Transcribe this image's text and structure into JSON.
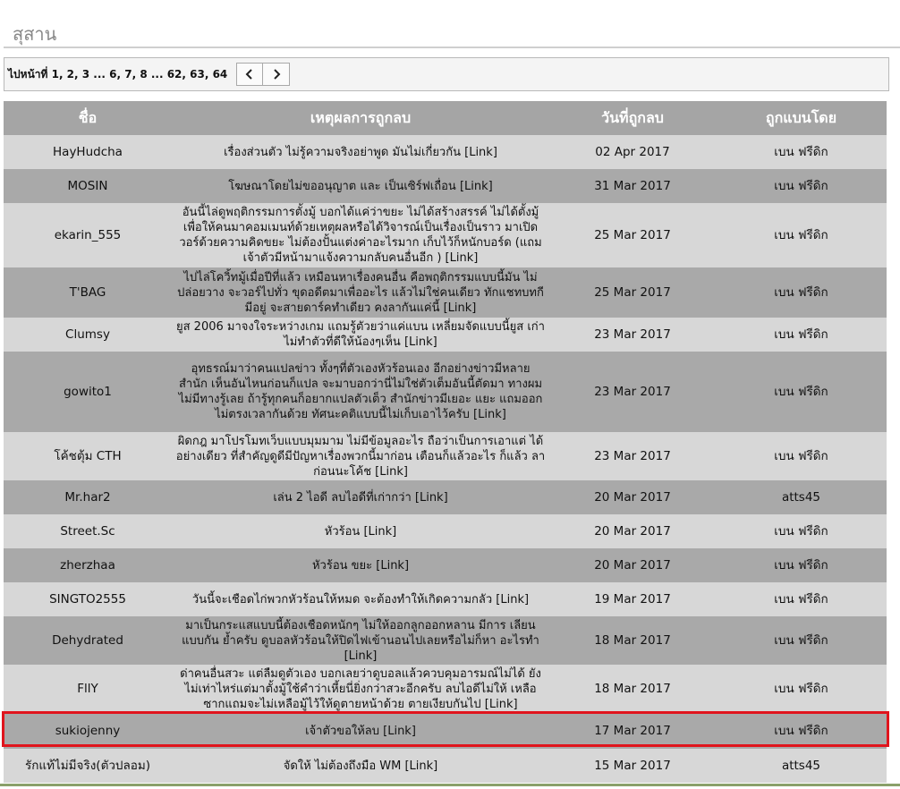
{
  "page": {
    "title": "สุสาน"
  },
  "pager": {
    "text": "ไปหน้าที่ 1, 2, 3 ... 6, 7, 8 ... 62, 63, 64"
  },
  "table": {
    "headers": [
      "ชื่อ",
      "เหตุผลการถูกลบ",
      "วันที่ถูกลบ",
      "ถูกแบนโดย"
    ],
    "rows": [
      {
        "name": "HayHudcha",
        "reason": "เรื่องส่วนตัว ไม่รู้ความจริงอย่าพูด มันไม่เกี่ยวกัน [Link]",
        "date": "02 Apr 2017",
        "by": "เบน ฟรีดิก"
      },
      {
        "name": "MOSIN",
        "reason": "โฆษณาโดยไม่ขออนุญาต และ เป็นเซิร์ฟเถื่อน [Link]",
        "date": "31 Mar 2017",
        "by": "เบน ฟรีดิก"
      },
      {
        "name": "ekarin_555",
        "reason": "อันนี้ไล่ดูพฤติกรรมการตั้งมู้ บอกได้แค่ว่าขยะ ไม่ได้สร้างสรรค์ ไม่ได้ตั้งมู้เพื่อให้คนมาคอมเมนท์ด้วยเหตุผลหรือได้วิจารณ์เป็นเรื่องเป็นราว มาเปิดวอร์ด้วยความคิดขยะ ไม่ต้องปั้นแต่งค่าอะไรมาก เก็บไว้ก็หนักบอร์ด (แถมเจ้าตัวมีหน้ามาแจ้งความกลับคนอื่นอีก ) [Link]",
        "date": "25 Mar 2017",
        "by": "เบน ฟรีดิก"
      },
      {
        "name": "T'BAG",
        "reason": "ไปไล่โควิ้ทมู้เมื่อปีที่แล้ว เหมือนหาเรื่องคนอื่น คือพฤติกรรมแบบนี้มัน ไม่ปล่อยวาง จะวอร์ไปทั่ว ขุดอดีตมาเพื่ออะไร แล้วไม่ใช่คนเดียว ทักแชทบทกีมีอยู่ จะสายดาร์คทำเดียว คงลากันแค่นี้ [Link]",
        "date": "25 Mar 2017",
        "by": "เบน ฟรีดิก"
      },
      {
        "name": "Clumsy",
        "reason": "ยูส 2006 มาจงใจระหว่างเกม แถมรู้ตัวยว่าแค่แบน เหลี่ยมจัดแบบนี้ยูส เก่าไม่ทำตัวที่ดีให้น้องๆเห็น [Link]",
        "date": "23 Mar 2017",
        "by": "เบน ฟรีดิก"
      },
      {
        "name": "gowito1",
        "reason": "อุทธรณ์มาว่าคนแปลข่าว ทั้งๆที่ตัวเองหัวร้อนเอง อีกอย่างข่าวมีหลาย สำนัก เห็นอันไหนก่อนก็แปล จะมาบอกว่านี่ไม่ใช่ตัวเต็มอันนี้ตัดมา ทางผมไม่มีทางรู้เลย ถ้ารู้ทุกคนก็อยากแปลตัวเต็ว สำนักข่าวมีเยอะ แยะ แถมออกไม่ตรงเวลากันด้วย ทัศนะคติแบบนี้ไม่เก็บเอาไว้ครับ [Link]",
        "date": "23 Mar 2017",
        "by": "เบน ฟรีดิก"
      },
      {
        "name": "โค้ชตุ้ม CTH",
        "reason": "ผิดกฎ มาโปรโมทเว็บแบบมุมมาม ไม่มีข้อมูลอะไร ถือว่าเป็นการเอาแต่ ได้อย่างเดียว ที่สำคัญดูดีมีปัญหาเรื่องพวกนี้มาก่อน เตือนก็แล้วอะไร ก็แล้ว ลาก่อนนะโค้ช [Link]",
        "date": "23 Mar 2017",
        "by": "เบน ฟรีดิก"
      },
      {
        "name": "Mr.har2",
        "reason": "เล่น 2 ไอดี ลบไอดีที่เก่ากว่า [Link]",
        "date": "20 Mar 2017",
        "by": "atts45"
      },
      {
        "name": "Street.Sc",
        "reason": "หัวร้อน [Link]",
        "date": "20 Mar 2017",
        "by": "เบน ฟรีดิก"
      },
      {
        "name": "zherzhaa",
        "reason": "หัวร้อน ขยะ [Link]",
        "date": "20 Mar 2017",
        "by": "เบน ฟรีดิก"
      },
      {
        "name": "SINGTO2555",
        "reason": "วันนี้จะเชือดไก่พวกหัวร้อนให้หมด จะต้องทำให้เกิดความกลัว [Link]",
        "date": "19 Mar 2017",
        "by": "เบน ฟรีดิก"
      },
      {
        "name": "Dehydrated",
        "reason": "มาเป็นกระแสแบบนี้ต้องเชือดหนักๆ ไม่ให้ออกลูกออกหลาน มีการ เลียนแบบกัน ย้ำครับ ดูบอลหัวร้อนให้ปิดไฟเข้านอนไปเลยหรือไม่ก็หา อะไรทำ [Link]",
        "date": "18 Mar 2017",
        "by": "เบน ฟรีดิก"
      },
      {
        "name": "FllY",
        "reason": "ด่าคนอื่นสวะ แต่ลืมดูตัวเอง บอกเลยว่าดูบอลแล้วควบคุมอารมณ์ไม่ได้ ยังไม่เท่าไหร่แต่มาตั้งมู้ใช้คำว่าเหี้ยนี่ยิ่งกว่าสวะอีกครับ ลบไอดีไม่ให้ เหลือซากแถมจะไม่เหลือมู้ไว้ให้ดูตายหน้าด้วย ตายเงียบกันไป [Link]",
        "date": "18 Mar 2017",
        "by": "เบน ฟรีดิก"
      },
      {
        "name": "sukiojenny",
        "reason": "เจ้าตัวขอให้ลบ [Link]",
        "date": "17 Mar 2017",
        "by": "เบน ฟรีดิก"
      },
      {
        "name": "รักแท้ไม่มีจริง(ตัวปลอม)",
        "reason": "จัดให้ ไม่ต้องถึงมือ WM [Link]",
        "date": "15 Mar 2017",
        "by": "atts45"
      }
    ]
  }
}
